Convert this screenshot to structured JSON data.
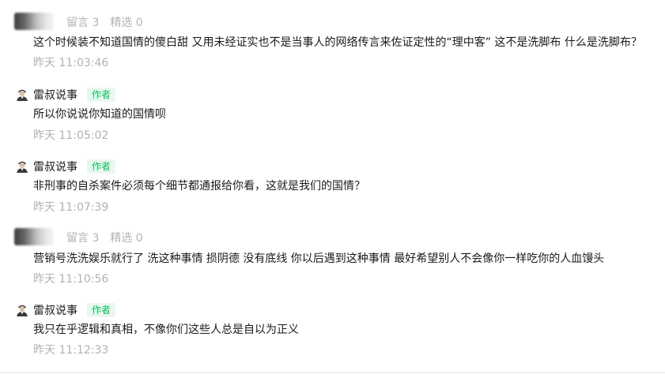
{
  "comments": [
    {
      "kind": "reader",
      "meta_liuyan": "留言 3",
      "meta_jingxuan": "精选 0",
      "text": "这个时候装不知道国情的傻白甜 又用未经证实也不是当事人的网络传言来佐证定性的“理中客” 这不是洗脚布 什么是洗脚布？",
      "time": "昨天 11:03:46"
    },
    {
      "kind": "author",
      "name": "雷叔说事",
      "badge": "作者",
      "text": "所以你说说你知道的国情呗",
      "time": "昨天 11:05:02"
    },
    {
      "kind": "author",
      "name": "雷叔说事",
      "badge": "作者",
      "text": "非刑事的自杀案件必须每个细节都通报给你看，这就是我们的国情？",
      "time": "昨天 11:07:39"
    },
    {
      "kind": "reader",
      "meta_liuyan": "留言 3",
      "meta_jingxuan": "精选 0",
      "text": "营销号洗洗娱乐就行了 洗这种事情 损阴德 没有底线 你以后遇到这种事情 最好希望别人不会像你一样吃你的人血馒头",
      "time": "昨天 11:10:56"
    },
    {
      "kind": "author",
      "name": "雷叔说事",
      "badge": "作者",
      "text": "我只在乎逻辑和真相，不像你们这些人总是自以为正义",
      "time": "昨天 11:12:33"
    }
  ],
  "colors": {
    "meta_gray": "#b2b2b2",
    "text_dark": "#1a1a1a",
    "badge_green": "#07c160",
    "badge_bg": "#eaf7ef"
  },
  "icons": {
    "author_avatar": "author-avatar-icon",
    "reader_avatar": "blurred-avatar"
  }
}
